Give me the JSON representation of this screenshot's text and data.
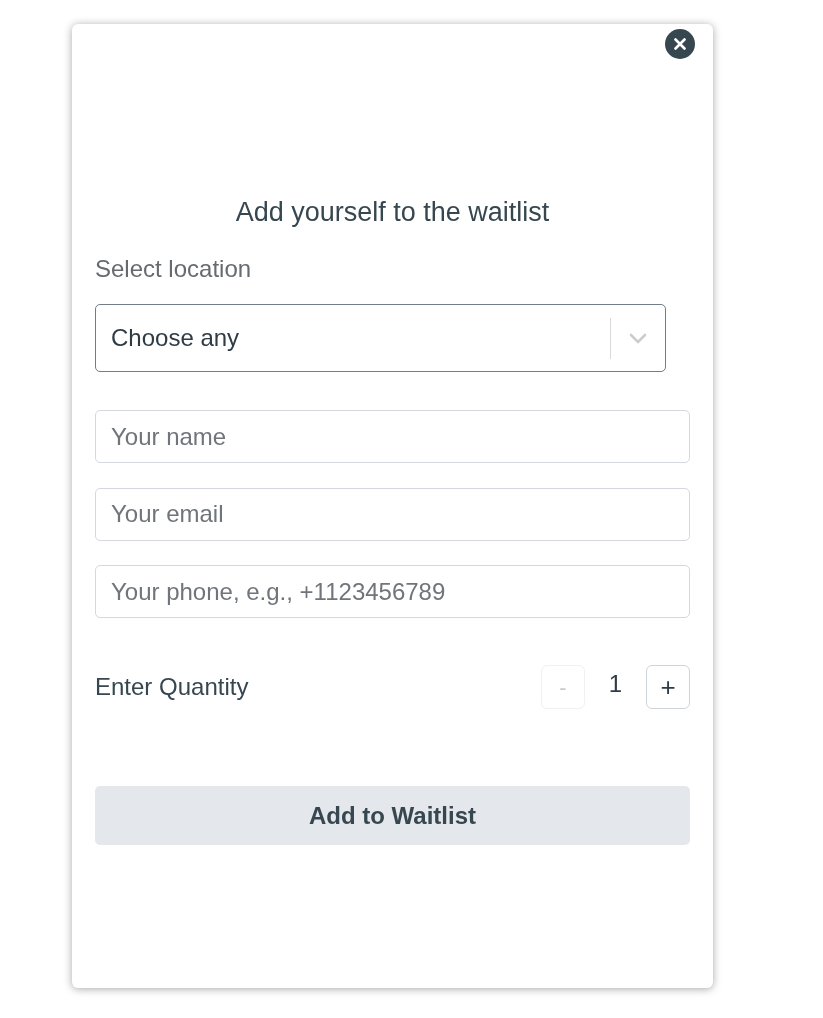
{
  "modal": {
    "title": "Add yourself to the waitlist",
    "location": {
      "label": "Select location",
      "value": "Choose any"
    },
    "fields": [
      {
        "placeholder": "Your name"
      },
      {
        "placeholder": "Your email"
      },
      {
        "placeholder": "Your phone, e.g., +1123456789"
      }
    ],
    "quantity": {
      "label": "Enter Quantity",
      "value": "1",
      "decrement": {
        "label": "-",
        "disabled": true
      },
      "increment": {
        "label": "+",
        "disabled": false
      }
    },
    "submit_button": "Add to Waitlist"
  }
}
